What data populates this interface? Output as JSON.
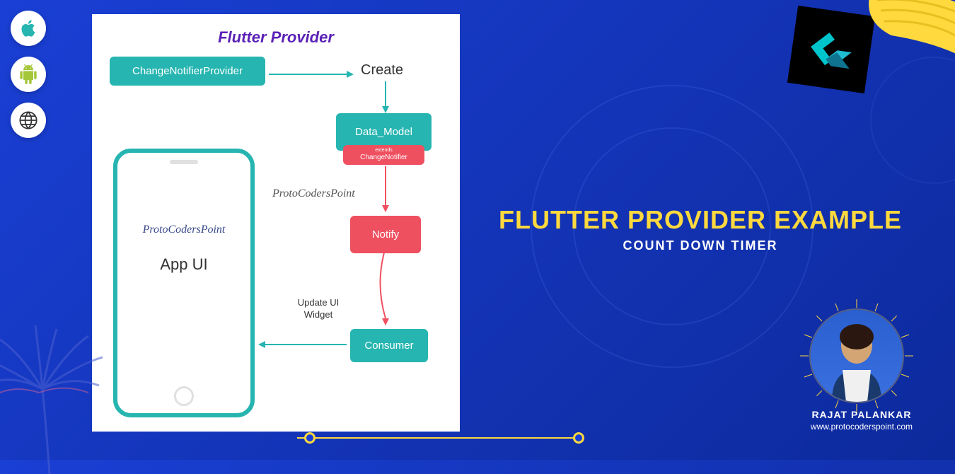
{
  "diagram": {
    "title": "Flutter Provider",
    "box_cnp": "ChangeNotifierProvider",
    "label_create": "Create",
    "box_datamodel": "Data_Model",
    "box_extends": "extends",
    "box_changenotifier": "ChangeNotifier",
    "label_watermark": "ProtoCodersPoint",
    "box_notify": "Notify",
    "label_update": "Update UI Widget",
    "box_consumer": "Consumer",
    "phone_brand": "ProtoCodersPoint",
    "phone_app": "App UI"
  },
  "hero": {
    "title": "FLUTTER PROVIDER EXAMPLE",
    "subtitle": "COUNT DOWN TIMER"
  },
  "author": {
    "name": "RAJAT PALANKAR",
    "site": "www.protocoderspoint.com"
  },
  "icons": {
    "apple": "apple-icon",
    "android": "android-icon",
    "web": "globe-icon"
  }
}
